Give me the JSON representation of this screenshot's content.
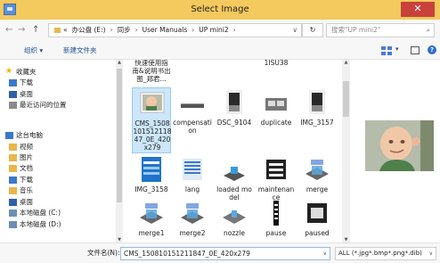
{
  "window": {
    "title": "Select Image",
    "close_glyph": "✕"
  },
  "nav": {
    "back_glyph": "←",
    "forward_glyph": "→",
    "up_glyph": "↑",
    "chevron_glyph": "«",
    "breadcrumbs": [
      "办公盘 (E:)",
      "同步",
      "User Manuals",
      "UP mini2"
    ],
    "refresh_glyph": "↻",
    "search_placeholder": "搜索\"UP mini2\"",
    "search_glyph": "⌕"
  },
  "toolbar": {
    "organize_label": "组织 ▾",
    "new_folder_label": "新建文件夹",
    "view_dropdown": "▾",
    "help_label": "?"
  },
  "sidebar": {
    "items": [
      {
        "label": "收藏夹",
        "icon": "star-icon",
        "color": "#f0b400"
      },
      {
        "label": "下载",
        "icon": "download-folder-icon",
        "color": "#3a78c9"
      },
      {
        "label": "桌面",
        "icon": "desktop-icon",
        "color": "#2e5fa8"
      },
      {
        "label": "最近访问的位置",
        "icon": "recent-places-icon",
        "color": "#8a8a8a"
      },
      {
        "label": "这台电脑",
        "icon": "computer-icon",
        "color": "#3a78c9"
      },
      {
        "label": "视频",
        "icon": "video-folder-icon",
        "color": "#e8b64a"
      },
      {
        "label": "图片",
        "icon": "pictures-folder-icon",
        "color": "#e8b64a"
      },
      {
        "label": "文档",
        "icon": "documents-folder-icon",
        "color": "#e8b64a"
      },
      {
        "label": "下载",
        "icon": "download-folder-icon",
        "color": "#3a78c9"
      },
      {
        "label": "音乐",
        "icon": "music-folder-icon",
        "color": "#e8b64a"
      },
      {
        "label": "桌面",
        "icon": "desktop-icon",
        "color": "#2e5fa8"
      },
      {
        "label": "本地磁盘 (C:)",
        "icon": "drive-icon",
        "color": "#6b8fb5"
      },
      {
        "label": "本地磁盘 (D:)",
        "icon": "drive-icon",
        "color": "#6b8fb5"
      }
    ]
  },
  "files": [
    {
      "name": "快速使用指南&说明书出图_郑君...",
      "icon": "folder-icon"
    },
    {
      "name": "1ISU38",
      "icon": "folder-icon"
    },
    {
      "name": "CMS_150810151211847_0E_420x279",
      "icon": "photo-thumbnail-icon",
      "selected": true
    },
    {
      "name": "compensation",
      "icon": "bed-level-thumbnail-icon"
    },
    {
      "name": "DSC_9104",
      "icon": "printer-photo-thumbnail-icon"
    },
    {
      "name": "duplicate",
      "icon": "duplicate-thumbnail-icon"
    },
    {
      "name": "IMG_3157",
      "icon": "printer-photo-thumbnail-icon"
    },
    {
      "name": "IMG_3158",
      "icon": "screenshot-thumbnail-icon"
    },
    {
      "name": "lang",
      "icon": "lang-thumbnail-icon"
    },
    {
      "name": "loaded model",
      "icon": "model-thumbnail-icon"
    },
    {
      "name": "maintenance",
      "icon": "maintenance-thumbnail-icon"
    },
    {
      "name": "merge",
      "icon": "merge-thumbnail-icon"
    },
    {
      "name": "merge1",
      "icon": "merge-thumbnail-icon"
    },
    {
      "name": "merge2",
      "icon": "merge-thumbnail-icon"
    },
    {
      "name": "nozzle",
      "icon": "nozzle-thumbnail-icon"
    },
    {
      "name": "pause",
      "icon": "pause-thumbnail-icon"
    },
    {
      "name": "paused",
      "icon": "paused-thumbnail-icon"
    }
  ],
  "bottom": {
    "filename_label": "文件名(N):",
    "filename_value": "CMS_150810151211847_0E_420x279",
    "filetype_value": "ALL (*.jpg*.bmp*.png*.dib)",
    "dropdown_glyph": "∨"
  },
  "colors": {
    "titlebar": "#f4c95d",
    "close": "#c8423b",
    "selection": "#cde6fb"
  }
}
